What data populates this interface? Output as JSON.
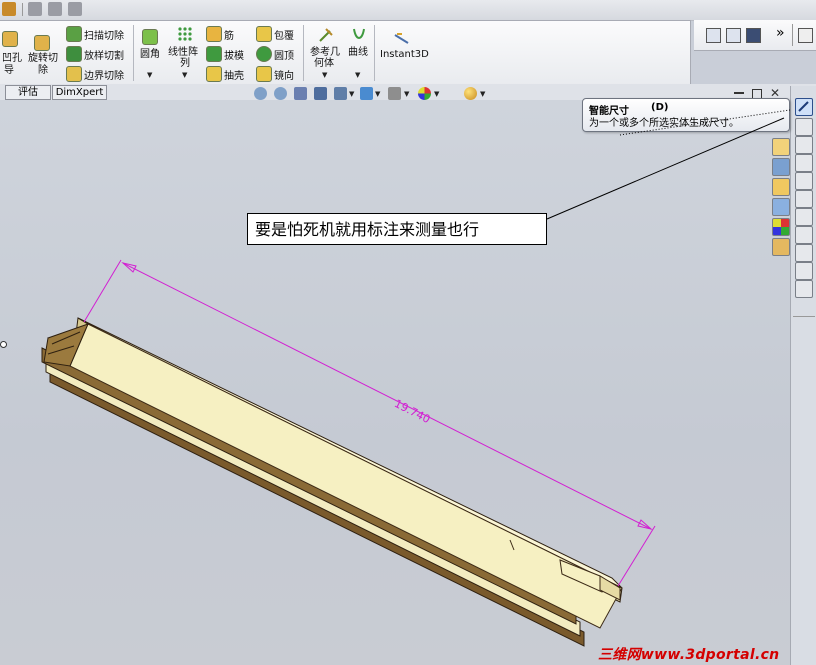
{
  "ribbon": {
    "group1": [
      "凹孔",
      "导",
      "旋转切",
      "除"
    ],
    "sweep_cut": "扫描切除",
    "loft_cut": "放样切割",
    "boundary_cut": "边界切除",
    "fillet": "圆角",
    "linear_pattern_line1": "线性阵",
    "linear_pattern_line2": "列",
    "rib": "筋",
    "draft": "拔模",
    "shell": "抽壳",
    "wrap": "包覆",
    "dome": "圆顶",
    "mirror": "镜向",
    "ref_geom_line1": "参考几",
    "ref_geom_line2": "何体",
    "curves": "曲线",
    "instant3d": "Instant3D",
    "more": "»"
  },
  "tabs": {
    "evaluate": "评估",
    "dimxpert": "DimXpert"
  },
  "tooltip": {
    "title": "智能尺寸",
    "shortcut": "(D)",
    "desc": "为一个或多个所选实体生成尺寸。"
  },
  "annotation": "要是怕死机就用标注来测量也行",
  "dimension_value": "19.740",
  "watermark": "三维网www.3dportal.cn",
  "colors": {
    "dimension": "#d21fd2",
    "part_fill": "#f6f0c2",
    "part_edge": "#3c2a16",
    "watermark": "#d40000"
  }
}
